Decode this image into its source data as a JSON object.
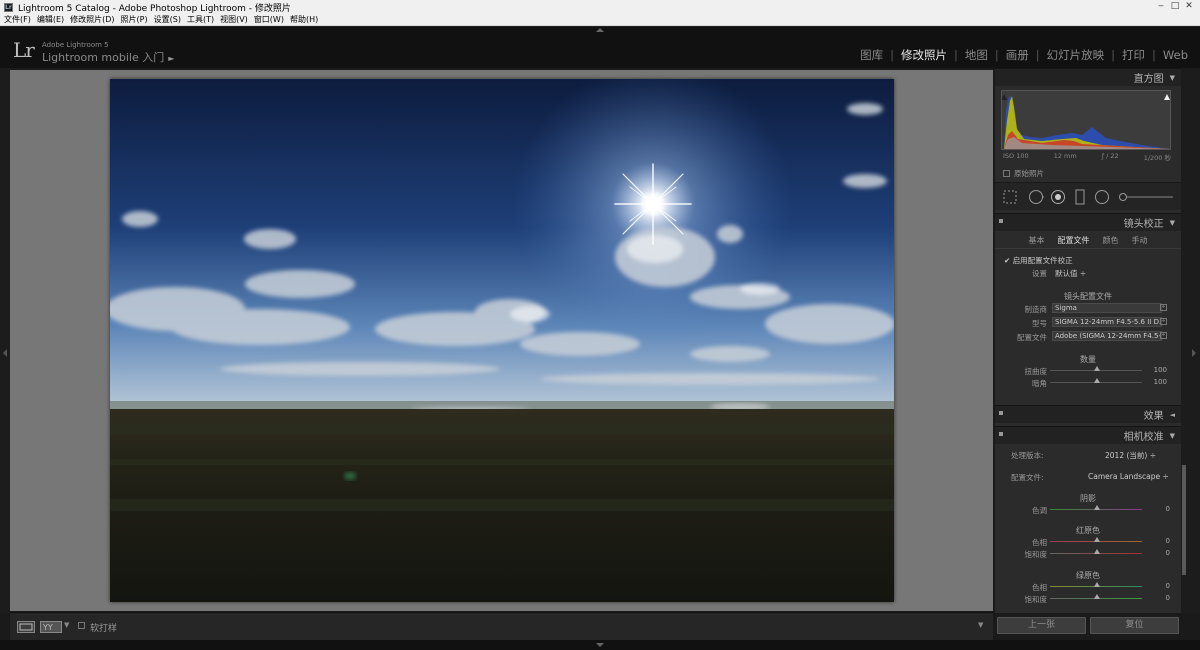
{
  "window": {
    "title": "Lightroom 5 Catalog - Adobe Photoshop Lightroom - 修改照片",
    "app_icon_text": "Lr"
  },
  "menu": [
    "文件(F)",
    "编辑(E)",
    "修改照片(D)",
    "照片(P)",
    "设置(S)",
    "工具(T)",
    "视图(V)",
    "窗口(W)",
    "帮助(H)"
  ],
  "identity": {
    "logo": "Lr",
    "product": "Adobe Lightroom 5",
    "mobile_text": "Lightroom mobile 入门",
    "arrow": "►"
  },
  "modules": [
    {
      "label": "图库",
      "active": false
    },
    {
      "label": "修改照片",
      "active": true
    },
    {
      "label": "地图",
      "active": false
    },
    {
      "label": "画册",
      "active": false
    },
    {
      "label": "幻灯片放映",
      "active": false
    },
    {
      "label": "打印",
      "active": false
    },
    {
      "label": "Web",
      "active": false
    }
  ],
  "histogram": {
    "title": "直方图",
    "toggle": "▼",
    "iso": "ISO 100",
    "focal": "12 mm",
    "aperture": "ƒ / 22",
    "shutter": "1/200 秒",
    "original_label": "原始照片"
  },
  "lens": {
    "title": "镜头校正",
    "toggle": "▼",
    "tabs": [
      {
        "label": "基本",
        "active": false
      },
      {
        "label": "配置文件",
        "active": true
      },
      {
        "label": "颜色",
        "active": false
      },
      {
        "label": "手动",
        "active": false
      }
    ],
    "enable_label": "启用配置文件校正",
    "setup_label": "设置",
    "setup_value": "默认值 ÷",
    "profile_section": "镜头配置文件",
    "maker_label": "制造商",
    "maker_value": "Sigma",
    "model_label": "型号",
    "model_value": "SIGMA 12-24mm F4.5-5.6 II D...",
    "profile_label": "配置文件",
    "profile_value": "Adobe (SIGMA 12-24mm F4.5-...",
    "amount_section": "数量",
    "distortion_label": "扭曲度",
    "distortion_value": "100",
    "vignette_label": "暗角",
    "vignette_value": "100"
  },
  "effects": {
    "title": "效果",
    "toggle": "◄"
  },
  "camera": {
    "title": "相机校准",
    "toggle": "▼",
    "process_label": "处理版本:",
    "process_value": "2012 (当前) ÷",
    "profile_label": "配置文件:",
    "profile_value": "Camera Landscape ÷",
    "shadow_section": "阴影",
    "shadow_tint_label": "色调",
    "shadow_tint_value": "0",
    "red_section": "红原色",
    "red_hue_label": "色相",
    "red_hue_value": "0",
    "red_sat_label": "饱和度",
    "red_sat_value": "0",
    "green_section": "绿原色",
    "green_hue_label": "色相",
    "green_hue_value": "0",
    "green_sat_label": "饱和度",
    "green_sat_value": "0"
  },
  "buttons": {
    "prev": "上一张",
    "reset": "复位"
  },
  "bottom": {
    "softproof_label": "软打样"
  }
}
